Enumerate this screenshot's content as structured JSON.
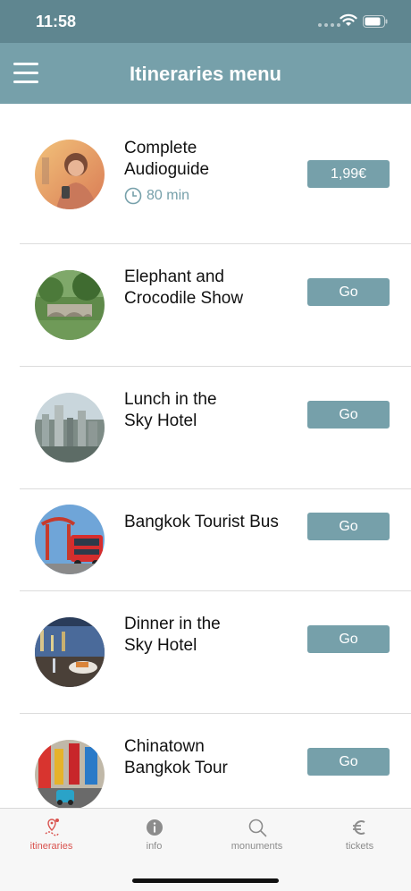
{
  "status": {
    "time": "11:58"
  },
  "nav": {
    "title": "Itineraries menu"
  },
  "items": [
    {
      "title": "Complete\nAudioguide",
      "duration": "80 min",
      "action": "1,99€"
    },
    {
      "title": "Elephant and\nCrocodile Show",
      "action": "Go"
    },
    {
      "title": "Lunch in the\nSky Hotel",
      "action": "Go"
    },
    {
      "title": "Bangkok Tourist Bus",
      "action": "Go"
    },
    {
      "title": "Dinner in the\nSky Hotel",
      "action": "Go"
    },
    {
      "title": "Chinatown\nBangkok Tour",
      "action": "Go"
    }
  ],
  "tabs": [
    {
      "label": "itineraries",
      "icon": "map-pin-icon",
      "active": true
    },
    {
      "label": "info",
      "icon": "info-icon",
      "active": false
    },
    {
      "label": "monuments",
      "icon": "search-icon",
      "active": false
    },
    {
      "label": "tickets",
      "icon": "euro-icon",
      "active": false
    }
  ],
  "colors": {
    "status_bar": "#5f8690",
    "nav_bar": "#76a0aa",
    "accent": "#76a0aa",
    "tab_active": "#d9534f"
  }
}
